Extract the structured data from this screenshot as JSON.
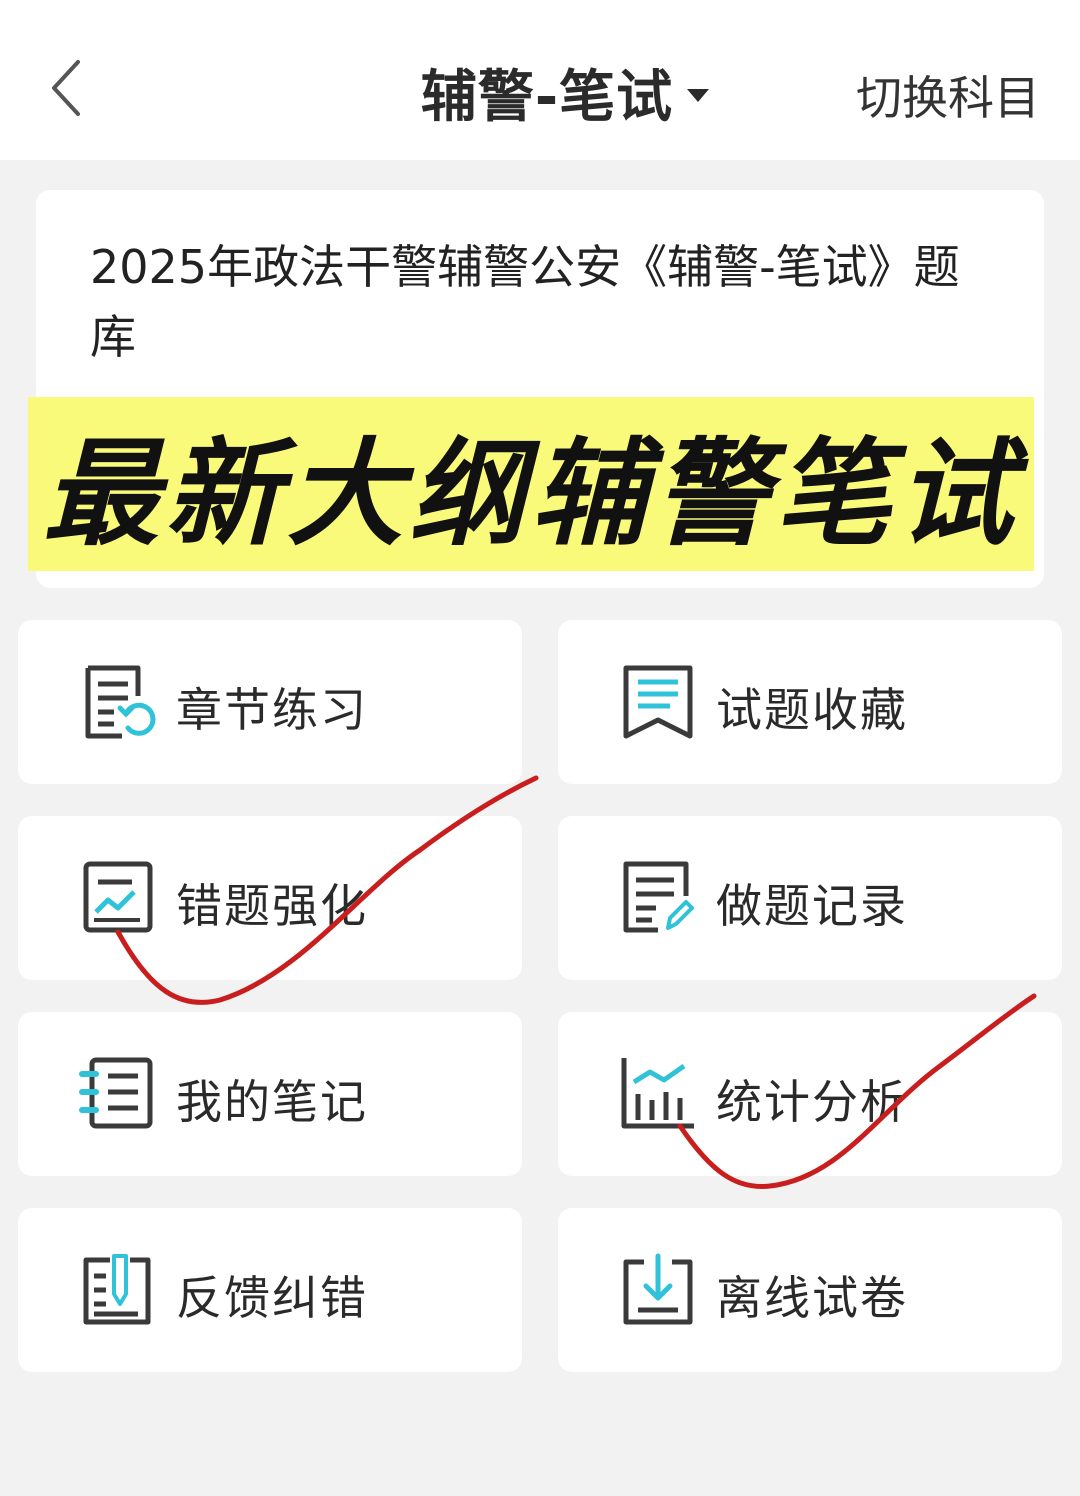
{
  "header": {
    "title": "辅警-笔试",
    "switch_label": "切换科目"
  },
  "info": {
    "title": "2025年政法干警辅警公安《辅警-笔试》题库",
    "banner_text": "最新大纲辅警笔试",
    "banner_color": "#fafa7a"
  },
  "menu": [
    {
      "label": "章节练习",
      "icon": "chapter-practice-icon"
    },
    {
      "label": "试题收藏",
      "icon": "bookmark-icon"
    },
    {
      "label": "错题强化",
      "icon": "trend-chart-icon"
    },
    {
      "label": "做题记录",
      "icon": "edit-record-icon"
    },
    {
      "label": "我的笔记",
      "icon": "notes-list-icon"
    },
    {
      "label": "统计分析",
      "icon": "bar-chart-icon"
    },
    {
      "label": "反馈纠错",
      "icon": "feedback-pen-icon"
    },
    {
      "label": "离线试卷",
      "icon": "download-icon"
    }
  ],
  "colors": {
    "accent": "#2fc2d8",
    "icon_stroke": "#3a3a3a",
    "annotation_red": "#c81e1e"
  }
}
